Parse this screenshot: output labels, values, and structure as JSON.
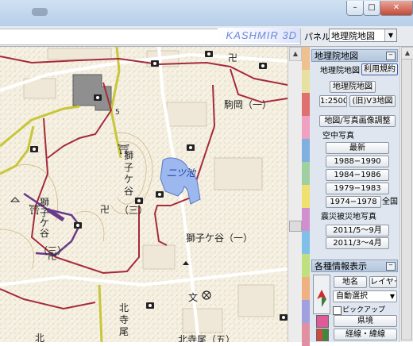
{
  "window": {
    "minimize_glyph": "–",
    "maximize_glyph": "□",
    "close_glyph": "✕"
  },
  "toolbar": {
    "logo_text": "KASHMIR 3D",
    "panel_label": "パネル",
    "panel_select_value": "地理院地図",
    "select_arrow": "▼"
  },
  "colors": {
    "strip": [
      "#f0c090",
      "#e8e0a0",
      "#e07070",
      "#f0a0c0",
      "#80b0e0",
      "#a0d0a0",
      "#f0e070",
      "#d090d0",
      "#80c0e8",
      "#c0e080",
      "#f0b080",
      "#a0a0e0",
      "#e090a0"
    ],
    "road_red": "#a52a3c",
    "road_yellow": "#c8c63a",
    "pond_blue": "#9db8ef"
  },
  "map": {
    "labels": {
      "komaoka": "駒岡（一）",
      "shishigaya_1": "獅子ケ谷（一）",
      "shishigaya_v": "獅\n子\nケ\n谷",
      "shishigaya_3": "（三）",
      "futatsuike": "二ツ池",
      "kitaterao_v": "北\n寺\n尾",
      "kitaterao_5": "北寺尾（五）",
      "kita": "北",
      "num5": "5"
    },
    "symbols": {
      "temple": "卍",
      "shrine": "⛩",
      "school": "文",
      "camera": "📷"
    }
  },
  "panel": {
    "gsi_section": {
      "title": "地理院地図",
      "usage_button": "利用規約",
      "subtitle": "地理院地図",
      "gsi_map_button": "地理院地図",
      "scale_button": "1:2500",
      "old_v3_button": "(旧)V3地図",
      "adjust_button": "地図/写真画像調整",
      "aerial_label": "空中写真",
      "latest_button": "最新",
      "period_buttons": [
        "1988−1990",
        "1984−1986",
        "1979−1983",
        "1974−1978"
      ],
      "nationwide_label": "全国",
      "disaster_label": "震災被災地写真",
      "disaster_buttons": [
        "2011/5〜9月",
        "2011/3〜4月"
      ]
    },
    "info_section": {
      "title": "各種情報表示",
      "place_name_button": "地名",
      "layer_button": "レイヤー",
      "auto_select_value": "自動選択",
      "popup_label": "ピックアップ",
      "border_button": "県境",
      "latlon_button": "経線・緯線"
    }
  }
}
